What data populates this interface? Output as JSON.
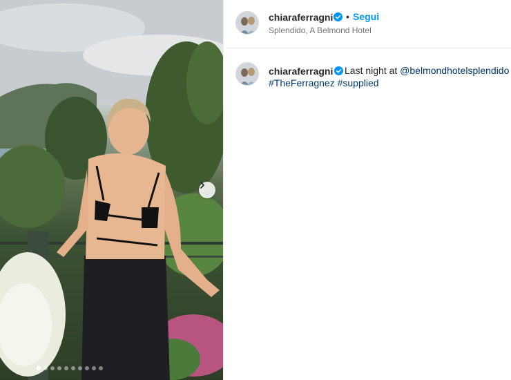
{
  "post": {
    "username": "chiaraferragni",
    "follow_label": "Segui",
    "separator": "•",
    "location": "Splendido, A Belmond Hotel"
  },
  "comment": {
    "username": "chiaraferragni",
    "text": "Last night at",
    "mention": "@belmondhotelsplendido",
    "hashtag_1": "#TheFerragnez",
    "hashtag_2": "#supplied"
  },
  "carousel": {
    "slide_count": 10,
    "active_index": 0
  },
  "colors": {
    "accent": "#0095f6",
    "link": "#00376b",
    "verified": "#0095f6",
    "secondary_text": "#737373"
  },
  "icons": [
    "verified-badge-icon",
    "chevron-right-icon"
  ]
}
